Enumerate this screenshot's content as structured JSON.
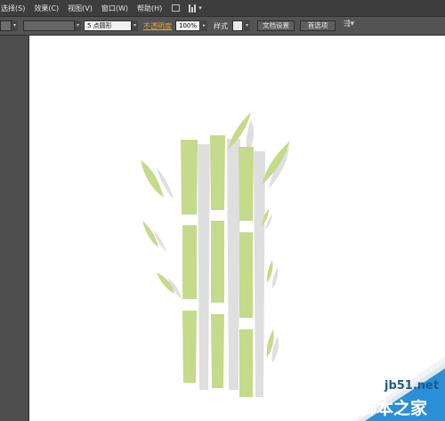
{
  "menubar": {
    "items": [
      "选择(S)",
      "效果(C)",
      "视图(V)",
      "窗口(W)",
      "帮助(H)"
    ],
    "icons": [
      "bridge-icon",
      "arrange-documents-icon"
    ]
  },
  "controlbar": {
    "stroke_profile": "5 点圆形",
    "opacity_label": "不透明度",
    "opacity_value": "100%",
    "style_label": "样式",
    "document_setup_button": "文档设置",
    "preferences_button": "首选项"
  },
  "colors": {
    "menubar_bg": "#3d3d3d",
    "controlbar_bg": "#535353",
    "canvas_bg": "#ffffff",
    "pasteboard_bg": "#4d4d4d",
    "bamboo_green": "#c5da8a",
    "bamboo_shadow": "#dcdcdc",
    "opacity_link": "#e8a23a"
  },
  "artwork": {
    "description_icon": "bamboo-illustration",
    "stalk_count": 3,
    "leaf_count": 10
  },
  "watermark": {
    "site": "jb51.net",
    "name": "脚本之家"
  }
}
